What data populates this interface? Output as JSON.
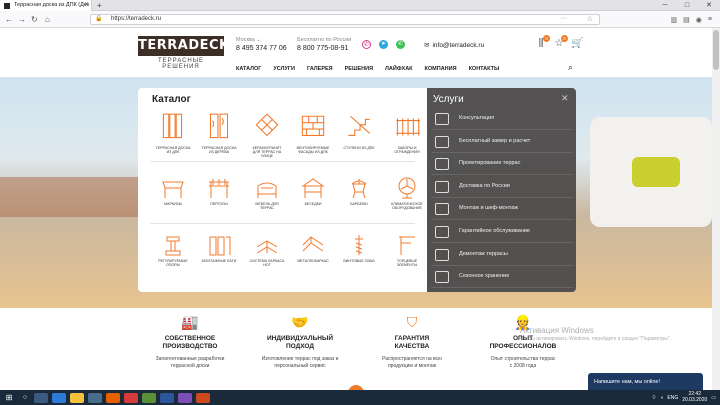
{
  "browser": {
    "tab_title": "Террасная доска из ДПК (Дек",
    "url": "https://terradeck.ru"
  },
  "header": {
    "logo_top": "TERRADECK",
    "logo_sub": "ТЕРРАСНЫЕ РЕШЕНИЯ",
    "city": "Москва",
    "phone1": "8 495 374 77 06",
    "free_label": "Бесплатно по России",
    "phone2": "8 800 775-08-91",
    "email": "info@terradeck.ru",
    "badges": [
      "0",
      "0"
    ]
  },
  "menu": [
    "КАТАЛОГ",
    "УСЛУГИ",
    "ГАЛЕРЕЯ",
    "РЕШЕНИЯ",
    "ЛАЙФХАК",
    "КОМПАНИЯ",
    "КОНТАКТЫ"
  ],
  "catalog": {
    "title": "Каталог",
    "items": [
      [
        "ТЕРРАСНАЯ ДОСКА",
        "ИЗ ДПК"
      ],
      [
        "ТЕРРАСНАЯ ДОСКА",
        "ИЗ ДЕРЕВА"
      ],
      [
        "КЕРАМОГРАНИТ",
        "ДЛЯ ТЕРРАС НА",
        "УЛИЦЕ"
      ],
      [
        "ВЕНТИЛИРУЕМЫЕ",
        "ФАСАДЫ ИЗ ДПК"
      ],
      [
        "СТУПЕНИ ИЗ ДПК"
      ],
      [
        "ЗАБОРЫ И",
        "ОГРАЖДЕНИЯ"
      ],
      [
        "МАРКИЗЫ"
      ],
      [
        "ПЕРГОЛЫ"
      ],
      [
        "МЕБЕЛЬ ДЛЯ",
        "ТЕРРАС"
      ],
      [
        "БЕСЕДКИ"
      ],
      [
        "БАРБЕКЮ"
      ],
      [
        "КЛИМАТИЧЕСКОЕ",
        "ОБОРУДОВАНИЕ"
      ],
      [
        "РЕГУЛИРУЕМЫЕ",
        "ОПОРЫ"
      ],
      [
        "МОНТАЖНЫЕ ЛАГИ"
      ],
      [
        "СИСТЕМА КАРКАСА",
        "НОТ"
      ],
      [
        "МЕТАЛЛОКАРКАС"
      ],
      [
        "ВИНТОВЫЕ СВАИ"
      ],
      [
        "ТОРЦЕВЫЕ",
        "ЭЛЕМЕНТЫ"
      ]
    ]
  },
  "services": {
    "title": "Услуги",
    "items": [
      "Консультация",
      "Бесплатный замер и расчет",
      "Проектирование террас",
      "Доставка по России",
      "Монтаж и шеф-монтаж",
      "Гарантийное обслуживание",
      "Демонтаж террасы",
      "Сезонное хранение"
    ]
  },
  "features": [
    {
      "h1": "СОБСТВЕННОЕ",
      "h2": "ПРОИЗВОДСТВО",
      "d1": "Запатентованные разработки",
      "d2": "террасной доски"
    },
    {
      "h1": "ИНДИВИДУАЛЬНЫЙ",
      "h2": "ПОДХОД",
      "d1": "Изготовление террас под заказ и",
      "d2": "персональный сервис"
    },
    {
      "h1": "ГАРАНТИЯ",
      "h2": "КАЧЕСТВА",
      "d1": "Распространяется на всю",
      "d2": "продукцию и монтаж"
    },
    {
      "h1": "ОПЫТ",
      "h2": "ПРОФЕССИОНАЛОВ",
      "d1": "Опыт строительства террас",
      "d2": "с 2008 года"
    }
  ],
  "activate": {
    "line1": "Активация Windows",
    "line2": "Чтобы активировать Windows, перейдите в раздел \"Параметры\"."
  },
  "chat_text": "Напишите нам, мы online!",
  "tray": {
    "lang": "ENG",
    "time": "22:42",
    "date": "20.03.2020"
  },
  "colors": {
    "accent": "#f07b2c",
    "logo_bg": "#3d2f26",
    "services_bg": "#4f4c4c"
  }
}
